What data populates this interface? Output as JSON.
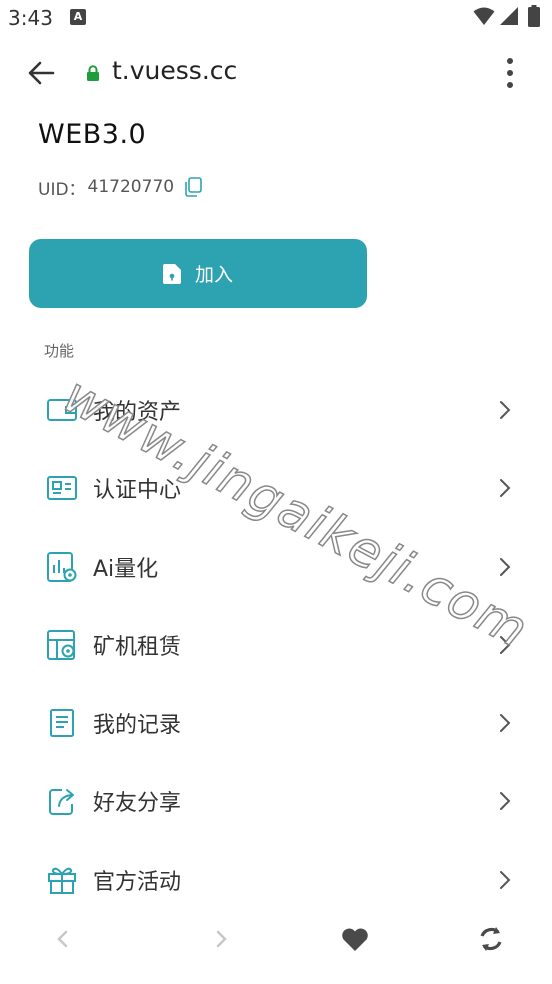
{
  "status_bar": {
    "time": "3:43",
    "notification_icon": "font-icon-A",
    "wifi_icon": "wifi-icon",
    "signal_icon": "signal-icon",
    "battery_icon": "battery-icon"
  },
  "browser": {
    "url": "t.vuess.cc",
    "back_icon": "arrow-left-icon",
    "lock_icon": "lock-icon",
    "menu_icon": "more-vert-icon",
    "lock_color": "#1e9e3a"
  },
  "header": {
    "title": "WEB3.0",
    "uid_label": "UID：",
    "uid_value": "41720770",
    "copy_icon": "copy-icon"
  },
  "join_button": {
    "label": "加入",
    "icon": "document-lock-icon",
    "color": "#2da3b1"
  },
  "section": {
    "label": "功能"
  },
  "menu": {
    "items": [
      {
        "label": "我的资产",
        "icon": "wallet-icon"
      },
      {
        "label": "认证中心",
        "icon": "id-card-icon"
      },
      {
        "label": "Ai量化",
        "icon": "chart-gear-icon"
      },
      {
        "label": "矿机租赁",
        "icon": "machine-gear-icon"
      },
      {
        "label": "我的记录",
        "icon": "record-doc-icon"
      },
      {
        "label": "好友分享",
        "icon": "share-icon"
      },
      {
        "label": "官方活动",
        "icon": "gift-icon"
      }
    ],
    "icon_color": "#2da3b1"
  },
  "watermark": {
    "text": "www.jingaikeji.com"
  },
  "bottom_nav": {
    "back_icon": "chevron-left-icon",
    "forward_icon": "chevron-right-icon",
    "favorite_icon": "heart-icon",
    "refresh_icon": "refresh-icon"
  }
}
